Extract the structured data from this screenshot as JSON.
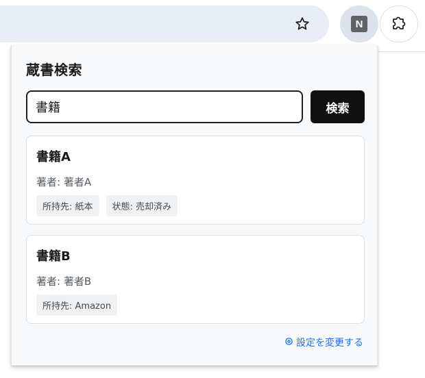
{
  "toolbar": {
    "star_icon": "star-outline-icon",
    "extension_badge": "N",
    "puzzle_icon": "puzzle-piece-icon"
  },
  "popup": {
    "title": "蔵書検索",
    "search": {
      "value": "書籍",
      "placeholder": ""
    },
    "search_button_label": "検索",
    "results": [
      {
        "title": "書籍A",
        "author": "著者: 著者A",
        "tags": [
          "所持先: 紙本",
          "状態: 売却済み"
        ]
      },
      {
        "title": "書籍B",
        "author": "著者: 著者B",
        "tags": [
          "所持先: Amazon"
        ]
      }
    ],
    "settings_link": "設定を変更する",
    "settings_icon": "gear-icon"
  },
  "colors": {
    "accent_link": "#1a73e8",
    "button_bg": "#111111",
    "omnibox_bg": "#e9eef6"
  }
}
